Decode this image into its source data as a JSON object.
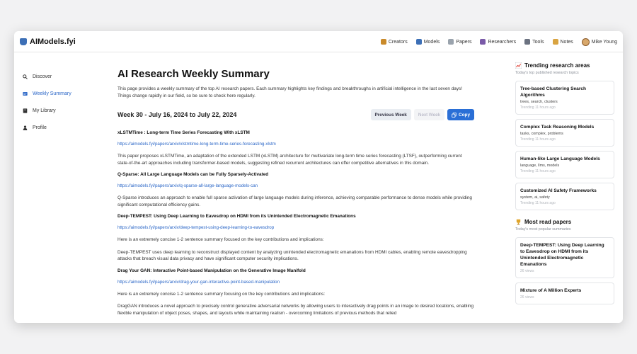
{
  "brand": {
    "name": "AIModels.fyi"
  },
  "nav": [
    {
      "label": "Creators",
      "color": "#c98a2a"
    },
    {
      "label": "Models",
      "color": "#3c6fb6"
    },
    {
      "label": "Papers",
      "color": "#9aa3ad"
    },
    {
      "label": "Researchers",
      "color": "#7a5aa8"
    },
    {
      "label": "Tools",
      "color": "#6b7280"
    },
    {
      "label": "Notes",
      "color": "#d9a441"
    }
  ],
  "user": {
    "name": "Mike Young"
  },
  "sidebar": [
    {
      "label": "Discover",
      "icon": "search-icon"
    },
    {
      "label": "Weekly Summary",
      "icon": "summary-icon"
    },
    {
      "label": "My Library",
      "icon": "book-icon"
    },
    {
      "label": "Profile",
      "icon": "user-icon"
    }
  ],
  "main": {
    "title": "AI Research Weekly Summary",
    "intro": "This page provides a weekly summary of the top AI research papers. Each summary highlights key findings and breakthroughs in artificial intelligence in the last seven days! Things change rapidly in our field, so be sure to check here regularly.",
    "week_title": "Week 30 - July 16, 2024 to July 22, 2024",
    "prev_label": "Previous Week",
    "next_label": "Next Week",
    "copy_label": "Copy",
    "papers": [
      {
        "title": "xLSTMTime : Long-term Time Series Forecasting With xLSTM",
        "link": "https://aimodels.fyi/papers/arxiv/xlstmtime-long-term-time-series-forecasting-xlstm",
        "texts": [
          "This paper proposes xLSTMTime, an adaptation of the extended LSTM (xLSTM) architecture for multivariate long-term time series forecasting (LTSF), outperforming current state-of-the-art approaches including transformer-based models, suggesting refined recurrent architectures can offer competitive alternatives in this domain."
        ]
      },
      {
        "title": "Q-Sparse: All Large Language Models can be Fully Sparsely-Activated",
        "link": "https://aimodels.fyi/papers/arxiv/q-sparse-all-large-language-models-can",
        "texts": [
          "Q-Sparse introduces an approach to enable full sparse activation of large language models during inference, achieving comparable performance to dense models while providing significant computational efficiency gains."
        ]
      },
      {
        "title": "Deep-TEMPEST: Using Deep Learning to Eavesdrop on HDMI from its Unintended Electromagnetic Emanations",
        "link": "https://aimodels.fyi/papers/arxiv/deep-tempest-using-deep-learning-to-eavesdrop",
        "texts": [
          "Here is an extremely concise 1-2 sentence summary focused on the key contributions and implications:",
          "Deep-TEMPEST uses deep learning to reconstruct displayed content by analyzing unintended electromagnetic emanations from HDMI cables, enabling remote eavesdropping attacks that breach visual data privacy and have significant computer security implications."
        ]
      },
      {
        "title": "Drag Your GAN: Interactive Point-based Manipulation on the Generative Image Manifold",
        "link": "https://aimodels.fyi/papers/arxiv/drag-your-gan-interactive-point-based-manipulation",
        "texts": [
          "Here is an extremely concise 1-2 sentence summary focusing on the key contributions and implications:",
          "DragGAN introduces a novel approach to precisely control generative adversarial networks by allowing users to interactively drag points in an image to desired locations, enabling flexible manipulation of object poses, shapes, and layouts while maintaining realism - overcoming limitations of previous methods that relied"
        ]
      }
    ]
  },
  "trending": {
    "title": "Trending research areas",
    "subtitle": "Today's top published research topics",
    "cards": [
      {
        "title": "Tree-based Clustering Search Algorithms",
        "tags": "trees, search, clusters",
        "meta": "Trending 11 hours ago"
      },
      {
        "title": "Complex Task Reasoning Models",
        "tags": "tasks, complex, problems",
        "meta": "Trending 11 hours ago"
      },
      {
        "title": "Human-like Large Language Models",
        "tags": "language, llms, models",
        "meta": "Trending 11 hours ago"
      },
      {
        "title": "Customized AI Safety Frameworks",
        "tags": "system, ai, safety",
        "meta": "Trending 11 hours ago"
      }
    ]
  },
  "most_read": {
    "title": "Most read papers",
    "subtitle": "Today's most popular summaries",
    "cards": [
      {
        "title": "Deep-TEMPEST: Using Deep Learning to Eavesdrop on HDMI from its Unintended Electromagnetic Emanations",
        "meta": "26 views"
      },
      {
        "title": "Mixture of A Million Experts",
        "meta": "26 views"
      }
    ]
  }
}
